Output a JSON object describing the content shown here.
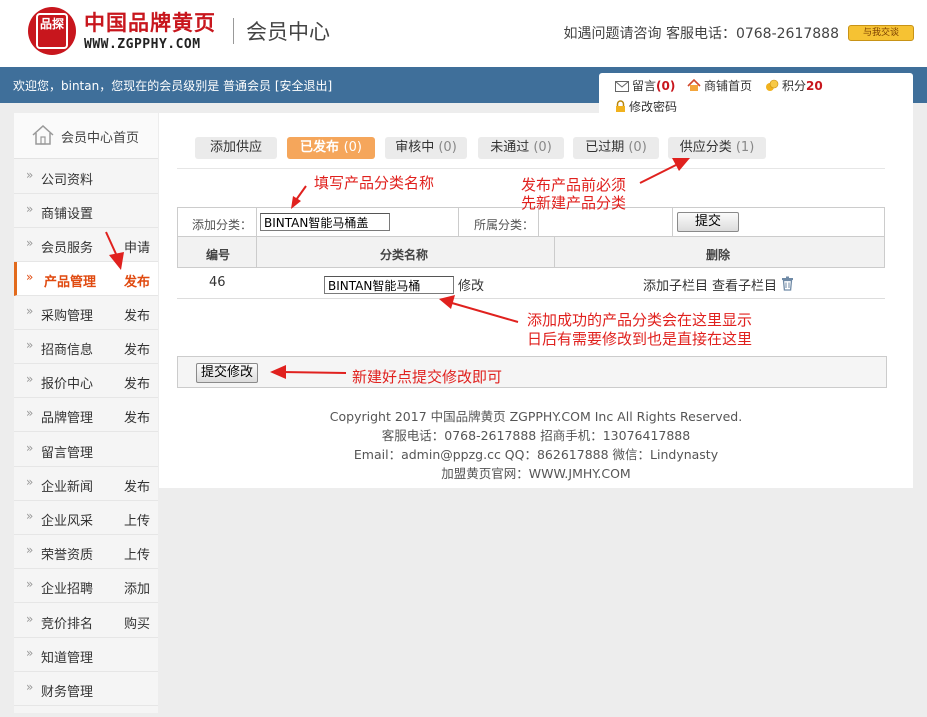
{
  "header": {
    "logo_seal": "品探",
    "logo_cn": "中国品牌黄页",
    "logo_en": "WWW.ZGPPHY.COM",
    "member_center": "会员中心",
    "hotline": "如遇问题请咨询 客服电话：0768-2617888",
    "qq_button": "与我交谈"
  },
  "topbar": {
    "welcome": "欢迎您，bintan，您现在的会员级别是 普通会员 [安全退出]"
  },
  "quick": {
    "messages_label": "留言",
    "messages_count": "(0)",
    "shop_home": "商铺首页",
    "points_label": "积分",
    "points_value": "20",
    "change_password": "修改密码"
  },
  "sidebar": {
    "home": "会员中心首页",
    "items": [
      {
        "name": "公司资料",
        "action": ""
      },
      {
        "name": "商铺设置",
        "action": ""
      },
      {
        "name": "会员服务",
        "action": "申请"
      },
      {
        "name": "产品管理",
        "action": "发布"
      },
      {
        "name": "采购管理",
        "action": "发布"
      },
      {
        "name": "招商信息",
        "action": "发布"
      },
      {
        "name": "报价中心",
        "action": "发布"
      },
      {
        "name": "品牌管理",
        "action": "发布"
      },
      {
        "name": "留言管理",
        "action": ""
      },
      {
        "name": "企业新闻",
        "action": "发布"
      },
      {
        "name": "企业风采",
        "action": "上传"
      },
      {
        "name": "荣誉资质",
        "action": "上传"
      },
      {
        "name": "企业招聘",
        "action": "添加"
      },
      {
        "name": "竞价排名",
        "action": "购买"
      },
      {
        "name": "知道管理",
        "action": ""
      },
      {
        "name": "财务管理",
        "action": ""
      }
    ]
  },
  "tabs": [
    {
      "label": "添加供应",
      "count": ""
    },
    {
      "label": "已发布",
      "count": "(0)"
    },
    {
      "label": "审核中",
      "count": "(0)"
    },
    {
      "label": "未通过",
      "count": "(0)"
    },
    {
      "label": "已过期",
      "count": "(0)"
    },
    {
      "label": "供应分类",
      "count": "(1)"
    }
  ],
  "form": {
    "add_label": "添加分类：",
    "add_value": "BINTAN智能马桶盖",
    "parent_label": "所属分类：",
    "submit_label": "提交"
  },
  "table": {
    "headers": [
      "编号",
      "分类名称",
      "删除"
    ],
    "row": {
      "id": "46",
      "name_value": "BINTAN智能马桶",
      "edit": "修改",
      "add_child": "添加子栏目",
      "view_child": "查看子栏目"
    }
  },
  "submit_edit": "提交修改",
  "footer": [
    "Copyright 2017 中国品牌黄页 ZGPPHY.COM Inc All Rights Reserved.",
    "客服电话：0768-2617888 招商手机：13076417888",
    "Email：admin@ppzg.cc   QQ：862617888 微信：Lindynasty",
    "加盟黄页官网：WWW.JMHY.COM"
  ],
  "notes": {
    "fill_name": "填写产品分类名称",
    "must_line1": "发布产品前必须",
    "must_line2": "先新建产品分类",
    "shown_line1": "添加成功的产品分类会在这里显示",
    "shown_line2": "日后有需要修改到也是直接在这里",
    "submit_hint": "新建好点提交修改即可"
  },
  "colors": {
    "brand_red": "#c8161d",
    "topbar_blue": "#3f6f9a",
    "active_tab": "#f5a65b",
    "annotation_red": "#e0211e"
  }
}
